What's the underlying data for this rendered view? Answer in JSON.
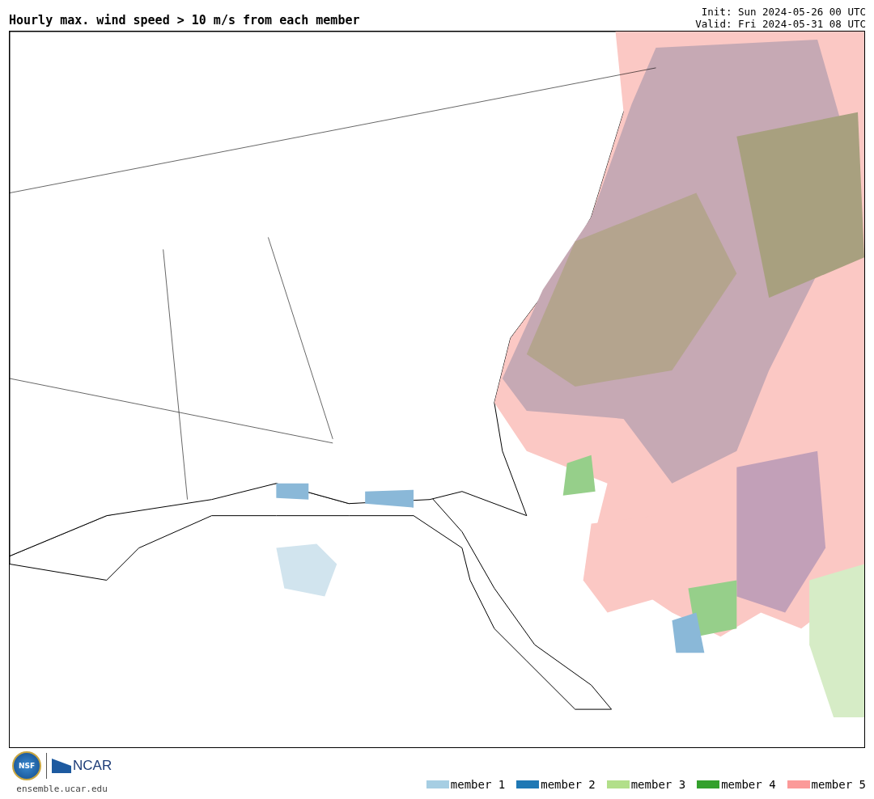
{
  "title": "Hourly max. wind speed > 10 m/s from each member",
  "init": "Init: Sun 2024-05-26 00 UTC",
  "valid": "Valid: Fri 2024-05-31 08 UTC",
  "logos": {
    "nsf": "NSF",
    "ncar": "NCAR",
    "site": "ensemble.ucar.edu"
  },
  "legend": [
    {
      "label": "member 1",
      "color": "#a6cee3"
    },
    {
      "label": "member 2",
      "color": "#1f78b4"
    },
    {
      "label": "member 3",
      "color": "#b2df8a"
    },
    {
      "label": "member 4",
      "color": "#33a02c"
    },
    {
      "label": "member 5",
      "color": "#fb9a99"
    }
  ]
}
